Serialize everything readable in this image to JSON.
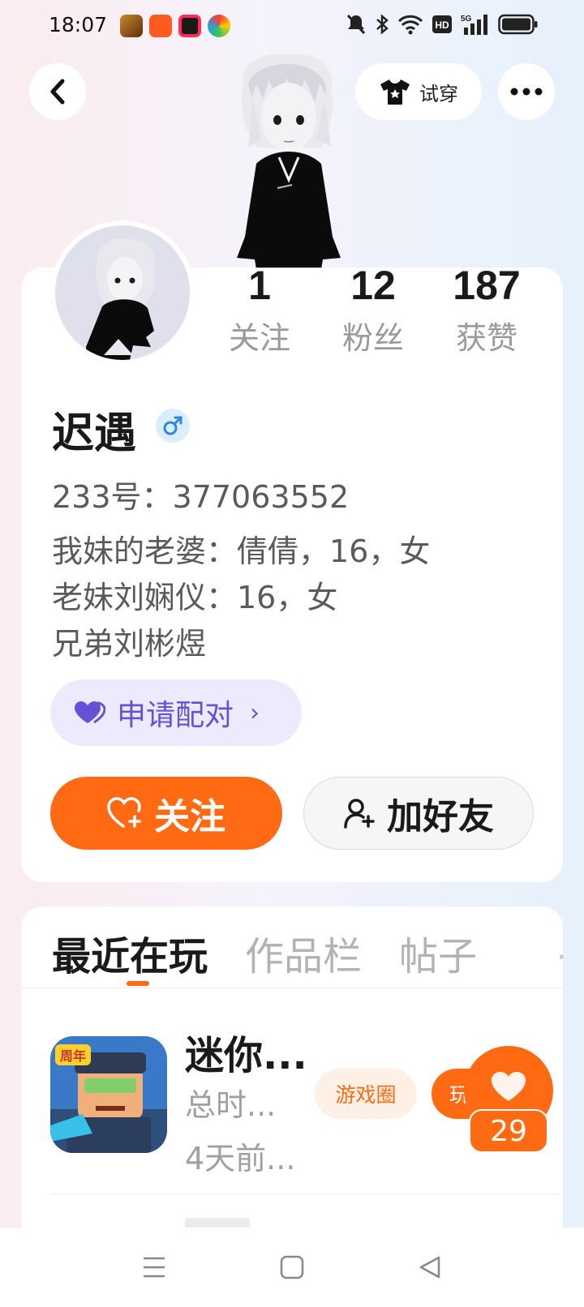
{
  "status_bar": {
    "time": "18:07",
    "app_icons": [
      "game-app-icon",
      "kuaishou-icon",
      "record-icon",
      "colorful-app-icon"
    ],
    "app_colors": [
      "#7a4a1a",
      "#ff5a1f",
      "#1a1a1a",
      "#2d9cdb"
    ],
    "icons": [
      "mute-icon",
      "bluetooth-icon",
      "wifi-icon",
      "hd-icon",
      "signal-5g-icon",
      "battery-icon"
    ],
    "network": "5G",
    "hd": "HD"
  },
  "header": {
    "back_icon": "chevron-left-icon",
    "tryon_label": "试穿",
    "tryon_icon": "tshirt-icon",
    "more_icon": "more-dots-icon"
  },
  "profile": {
    "stats": [
      {
        "value": "1",
        "label": "关注"
      },
      {
        "value": "12",
        "label": "粉丝"
      },
      {
        "value": "187",
        "label": "获赞"
      }
    ],
    "name": "迟遇",
    "gender_icon": "male-icon",
    "account_id": "233号：377063552",
    "bio": [
      "我妹的老婆：倩倩，16，女",
      "老妹刘娴仪：16，女",
      "兄弟刘彬煜"
    ],
    "pair_button": "申请配对",
    "follow_button": "关注",
    "add_friend_button": "加好友"
  },
  "tabs": {
    "items": [
      "最近在玩",
      "作品栏",
      "帖子"
    ],
    "more": "·",
    "active_index": 0
  },
  "recent_game": {
    "name": "迷你...",
    "total_time": "总时...",
    "last_played": "4天前...",
    "circle_button": "游戏圈",
    "play_button": "玩",
    "icon_badge": "周年"
  },
  "like": {
    "count": "29"
  },
  "nav_bar": {
    "icons": [
      "menu-icon",
      "home-square-icon",
      "back-triangle-icon"
    ]
  },
  "colors": {
    "accent": "#ff6a13",
    "pair_purple": "#6451d6",
    "pair_bg": "#ecebfd"
  }
}
